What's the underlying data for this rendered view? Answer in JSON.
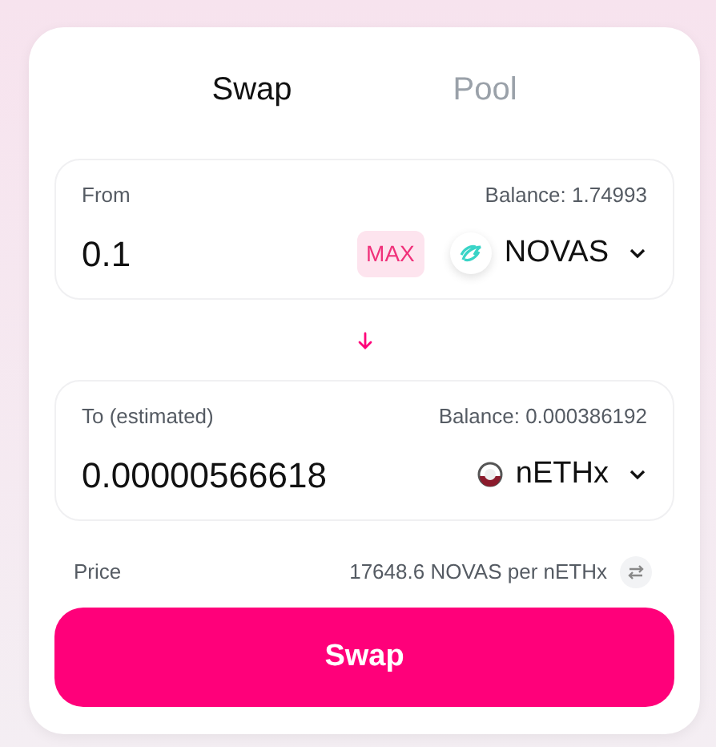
{
  "tabs": [
    {
      "label": "Swap",
      "selected": true
    },
    {
      "label": "Pool",
      "selected": false
    }
  ],
  "panels": [
    {
      "kind": "novas",
      "label": "From",
      "balance": "Balance: 1.74993",
      "value": "0.1",
      "max": "MAX",
      "token": "NOVAS"
    },
    {
      "kind": "neth",
      "label": "To (estimated)",
      "balance": "Balance: 0.000386192",
      "value": "0.00000566618",
      "token": "nETHx"
    }
  ],
  "price": {
    "label": "Price",
    "value": "17648.6 NOVAS per nETHx"
  },
  "button": "Swap"
}
